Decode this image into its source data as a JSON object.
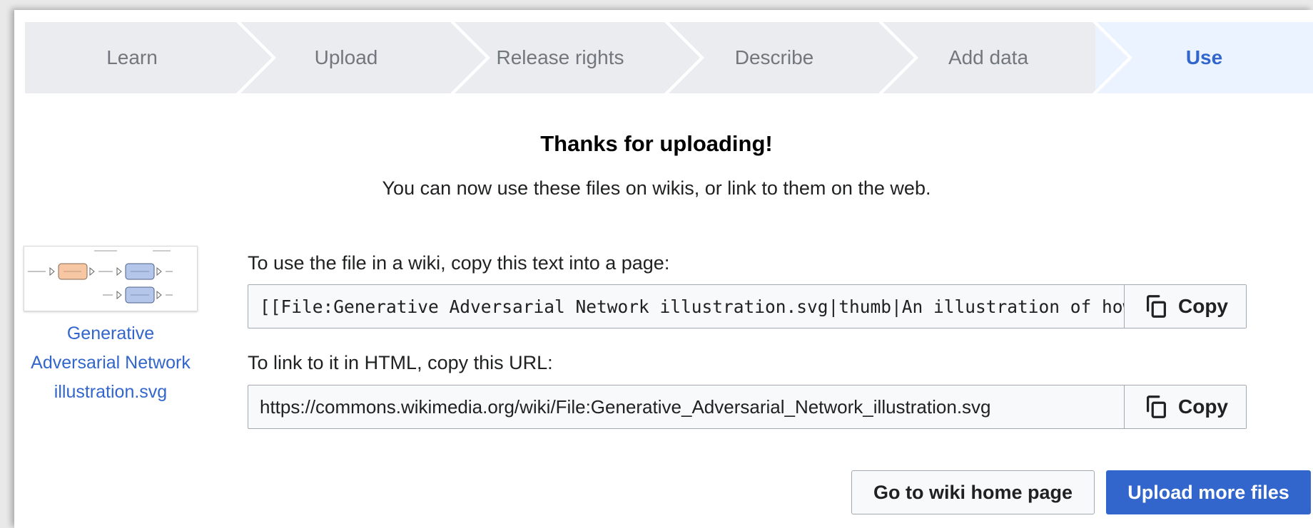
{
  "steps": {
    "learn": "Learn",
    "upload": "Upload",
    "release": "Release rights",
    "describe": "Describe",
    "adddata": "Add data",
    "use": "Use"
  },
  "heading": "Thanks for uploading!",
  "subheading": "You can now use these files on wikis, or link to them on the web.",
  "file": {
    "caption_line1": "Generative",
    "caption_line2": "Adversarial Network",
    "caption_line3": "illustration.svg"
  },
  "wiki": {
    "label": "To use the file in a wiki, copy this text into a page:",
    "value": "[[File:Generative Adversarial Network illustration.svg|thumb|An illustration of how"
  },
  "html": {
    "label": "To link to it in HTML, copy this URL:",
    "value": "https://commons.wikimedia.org/wiki/File:Generative_Adversarial_Network_illustration.svg"
  },
  "copy_label": "Copy",
  "buttons": {
    "home": "Go to wiki home page",
    "more": "Upload more files"
  },
  "colors": {
    "accent": "#3366cc",
    "step_bg": "#eaecf0",
    "active_step_bg": "#eaf3ff"
  }
}
